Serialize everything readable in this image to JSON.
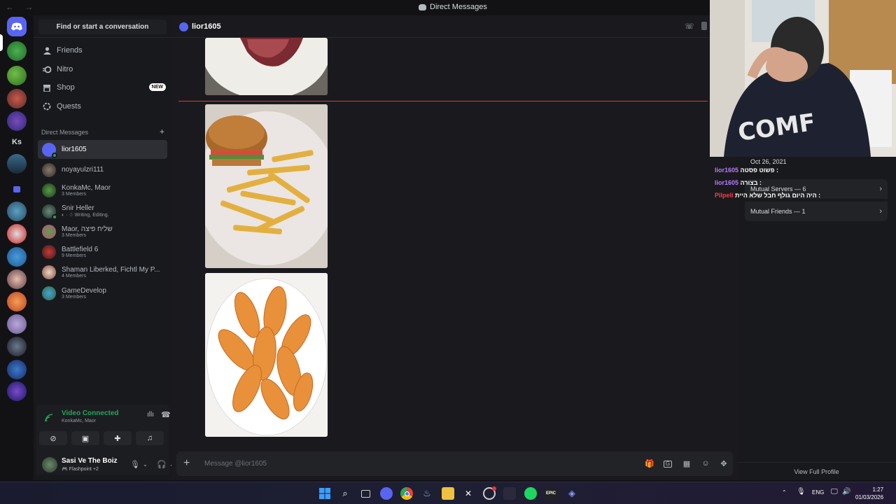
{
  "window": {
    "title": "Direct Messages",
    "nav": "← →"
  },
  "sidebar": {
    "search_label": "Find or start a conversation",
    "nav": [
      {
        "label": "Friends"
      },
      {
        "label": "Nitro"
      },
      {
        "label": "Shop",
        "badge": "NEW"
      },
      {
        "label": "Quests"
      }
    ],
    "dm_header": "Direct Messages",
    "dm_add": "+",
    "dms": [
      {
        "name": "lior1605",
        "sub": ""
      },
      {
        "name": "noyayulzri111",
        "sub": ""
      },
      {
        "name": "KonkaMc, Maor",
        "sub": "3 Members"
      },
      {
        "name": "Snir Heller",
        "sub": "Writing, Editing."
      },
      {
        "name": "Maor, שליח פיצה",
        "sub": "3 Members"
      },
      {
        "name": "Battlefield 6",
        "sub": "9 Members"
      },
      {
        "name": "Shaman Liberked, Fichtl My P...",
        "sub": "4 Members"
      },
      {
        "name": "GameDevelop",
        "sub": "3 Members"
      }
    ]
  },
  "rail": {
    "ks_label": "Ks"
  },
  "voice": {
    "status": "Video Connected",
    "channel": "KonkaMc, Maor"
  },
  "user": {
    "name": "Sasi Ve The Boiz",
    "status": "Flashpoint +2"
  },
  "chat": {
    "recipient": "lior1605",
    "composer_placeholder": "Message @lior1605"
  },
  "profile": {
    "member_since": "Oct 26, 2021",
    "mutual_servers": "Mutual Servers — 6",
    "mutual_friends": "Mutual Friends — 1",
    "view_full": "View Full Profile"
  },
  "stream_chat": [
    {
      "user": "lior1605",
      "text": "פשוט פסטה :"
    },
    {
      "user": "lior1605",
      "text": "בצורה :"
    },
    {
      "user": "Pilpeli",
      "text": "היה היום גולף חבל שלא היית :"
    }
  ],
  "webcam_shirt_text": "COMF",
  "taskbar": {
    "lang": "ENG",
    "time": "1:27",
    "date": "01/03/2026"
  },
  "colors": {
    "accent": "#5865f2",
    "online": "#23a55a",
    "new_line": "#d83c3e"
  }
}
